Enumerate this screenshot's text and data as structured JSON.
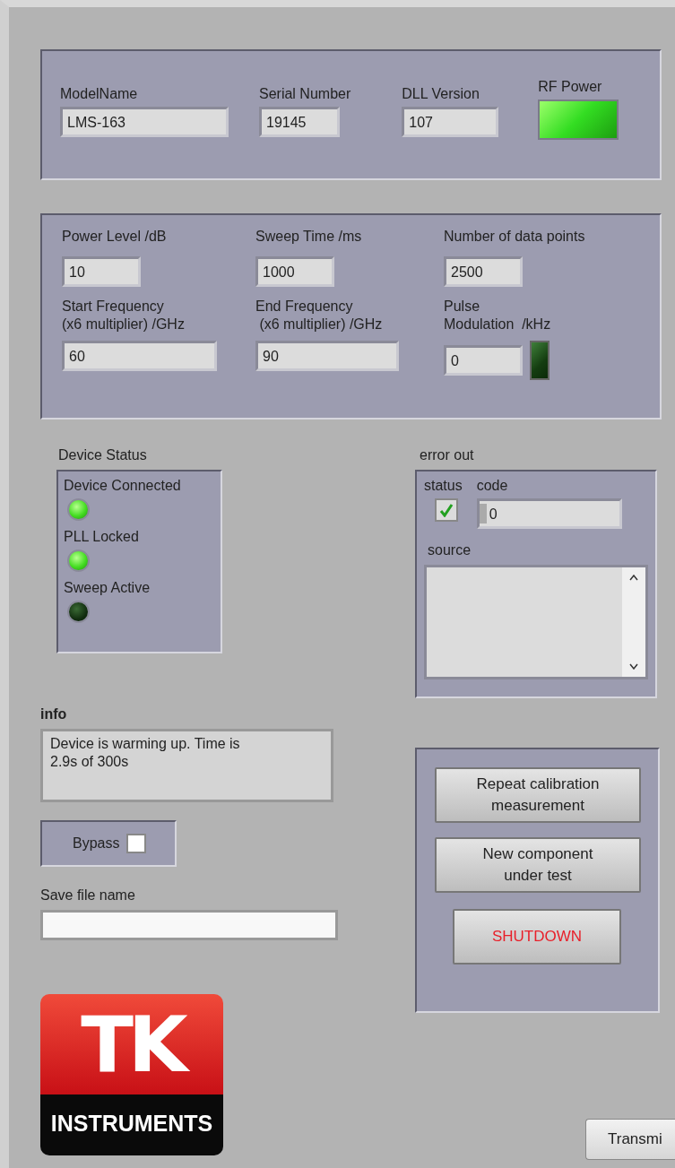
{
  "device_info": {
    "fields": [
      {
        "label": "ModelName",
        "value": "LMS-163"
      },
      {
        "label": "Serial Number",
        "value": "19145"
      },
      {
        "label": "DLL Version",
        "value": "107"
      }
    ],
    "rf_power": {
      "label": "RF Power",
      "on": true
    }
  },
  "settings": {
    "fields": [
      {
        "label": "Power Level /dB",
        "value": "10"
      },
      {
        "label": "Sweep Time /ms",
        "value": "1000"
      },
      {
        "label": "Number of data points",
        "value": "2500"
      },
      {
        "label": "Start Frequency\n(x6 multiplier) /GHz",
        "value": "60"
      },
      {
        "label": "End Frequency\n (x6 multiplier) /GHz",
        "value": "90"
      },
      {
        "label": "Pulse\nModulation  /kHz",
        "value": "0",
        "led_on": false
      }
    ]
  },
  "device_status": {
    "label": "Device Status",
    "indicators": [
      {
        "label": "Device Connected",
        "on": true
      },
      {
        "label": "PLL Locked",
        "on": true
      },
      {
        "label": "Sweep Active",
        "on": false
      }
    ]
  },
  "error_out": {
    "label": "error out",
    "status_label": "status",
    "status_checked": true,
    "code_label": "code",
    "code": "0",
    "source_label": "source"
  },
  "info": {
    "label": "info",
    "text": "Device is warming up. Time is 2.9s of 300s"
  },
  "bypass": {
    "label": "Bypass",
    "checked": false
  },
  "save_file": {
    "label": "Save file name"
  },
  "buttons": [
    {
      "label": "Repeat calibration\nmeasurement",
      "kind": "normal"
    },
    {
      "label": "New component\nunder test",
      "kind": "normal"
    },
    {
      "label": "SHUTDOWN",
      "kind": "danger"
    }
  ],
  "logo": {
    "top": "TK",
    "bottom": "INSTRUMENTS"
  },
  "transmit_button": {
    "label": "Transmi"
  }
}
